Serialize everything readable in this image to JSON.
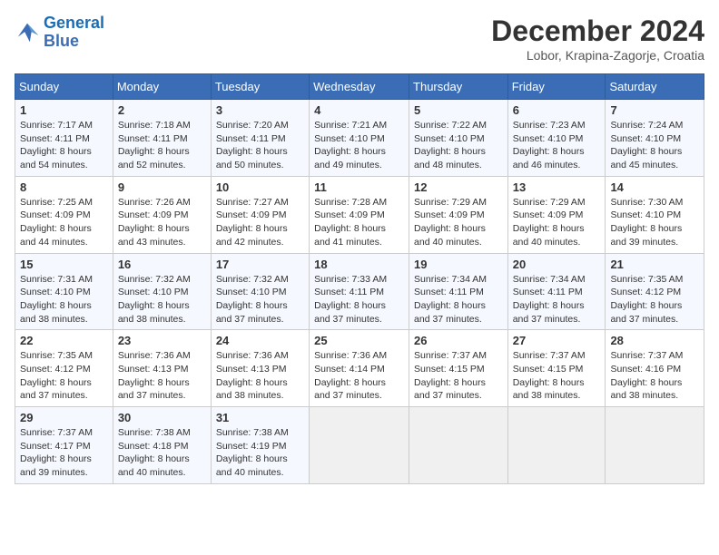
{
  "header": {
    "logo_line1": "General",
    "logo_line2": "Blue",
    "title": "December 2024",
    "location": "Lobor, Krapina-Zagorje, Croatia"
  },
  "weekdays": [
    "Sunday",
    "Monday",
    "Tuesday",
    "Wednesday",
    "Thursday",
    "Friday",
    "Saturday"
  ],
  "weeks": [
    [
      {
        "day": 1,
        "info": "Sunrise: 7:17 AM\nSunset: 4:11 PM\nDaylight: 8 hours\nand 54 minutes."
      },
      {
        "day": 2,
        "info": "Sunrise: 7:18 AM\nSunset: 4:11 PM\nDaylight: 8 hours\nand 52 minutes."
      },
      {
        "day": 3,
        "info": "Sunrise: 7:20 AM\nSunset: 4:11 PM\nDaylight: 8 hours\nand 50 minutes."
      },
      {
        "day": 4,
        "info": "Sunrise: 7:21 AM\nSunset: 4:10 PM\nDaylight: 8 hours\nand 49 minutes."
      },
      {
        "day": 5,
        "info": "Sunrise: 7:22 AM\nSunset: 4:10 PM\nDaylight: 8 hours\nand 48 minutes."
      },
      {
        "day": 6,
        "info": "Sunrise: 7:23 AM\nSunset: 4:10 PM\nDaylight: 8 hours\nand 46 minutes."
      },
      {
        "day": 7,
        "info": "Sunrise: 7:24 AM\nSunset: 4:10 PM\nDaylight: 8 hours\nand 45 minutes."
      }
    ],
    [
      {
        "day": 8,
        "info": "Sunrise: 7:25 AM\nSunset: 4:09 PM\nDaylight: 8 hours\nand 44 minutes."
      },
      {
        "day": 9,
        "info": "Sunrise: 7:26 AM\nSunset: 4:09 PM\nDaylight: 8 hours\nand 43 minutes."
      },
      {
        "day": 10,
        "info": "Sunrise: 7:27 AM\nSunset: 4:09 PM\nDaylight: 8 hours\nand 42 minutes."
      },
      {
        "day": 11,
        "info": "Sunrise: 7:28 AM\nSunset: 4:09 PM\nDaylight: 8 hours\nand 41 minutes."
      },
      {
        "day": 12,
        "info": "Sunrise: 7:29 AM\nSunset: 4:09 PM\nDaylight: 8 hours\nand 40 minutes."
      },
      {
        "day": 13,
        "info": "Sunrise: 7:29 AM\nSunset: 4:09 PM\nDaylight: 8 hours\nand 40 minutes."
      },
      {
        "day": 14,
        "info": "Sunrise: 7:30 AM\nSunset: 4:10 PM\nDaylight: 8 hours\nand 39 minutes."
      }
    ],
    [
      {
        "day": 15,
        "info": "Sunrise: 7:31 AM\nSunset: 4:10 PM\nDaylight: 8 hours\nand 38 minutes."
      },
      {
        "day": 16,
        "info": "Sunrise: 7:32 AM\nSunset: 4:10 PM\nDaylight: 8 hours\nand 38 minutes."
      },
      {
        "day": 17,
        "info": "Sunrise: 7:32 AM\nSunset: 4:10 PM\nDaylight: 8 hours\nand 37 minutes."
      },
      {
        "day": 18,
        "info": "Sunrise: 7:33 AM\nSunset: 4:11 PM\nDaylight: 8 hours\nand 37 minutes."
      },
      {
        "day": 19,
        "info": "Sunrise: 7:34 AM\nSunset: 4:11 PM\nDaylight: 8 hours\nand 37 minutes."
      },
      {
        "day": 20,
        "info": "Sunrise: 7:34 AM\nSunset: 4:11 PM\nDaylight: 8 hours\nand 37 minutes."
      },
      {
        "day": 21,
        "info": "Sunrise: 7:35 AM\nSunset: 4:12 PM\nDaylight: 8 hours\nand 37 minutes."
      }
    ],
    [
      {
        "day": 22,
        "info": "Sunrise: 7:35 AM\nSunset: 4:12 PM\nDaylight: 8 hours\nand 37 minutes."
      },
      {
        "day": 23,
        "info": "Sunrise: 7:36 AM\nSunset: 4:13 PM\nDaylight: 8 hours\nand 37 minutes."
      },
      {
        "day": 24,
        "info": "Sunrise: 7:36 AM\nSunset: 4:13 PM\nDaylight: 8 hours\nand 38 minutes."
      },
      {
        "day": 25,
        "info": "Sunrise: 7:36 AM\nSunset: 4:14 PM\nDaylight: 8 hours\nand 37 minutes."
      },
      {
        "day": 26,
        "info": "Sunrise: 7:37 AM\nSunset: 4:15 PM\nDaylight: 8 hours\nand 37 minutes."
      },
      {
        "day": 27,
        "info": "Sunrise: 7:37 AM\nSunset: 4:15 PM\nDaylight: 8 hours\nand 38 minutes."
      },
      {
        "day": 28,
        "info": "Sunrise: 7:37 AM\nSunset: 4:16 PM\nDaylight: 8 hours\nand 38 minutes."
      }
    ],
    [
      {
        "day": 29,
        "info": "Sunrise: 7:37 AM\nSunset: 4:17 PM\nDaylight: 8 hours\nand 39 minutes."
      },
      {
        "day": 30,
        "info": "Sunrise: 7:38 AM\nSunset: 4:18 PM\nDaylight: 8 hours\nand 40 minutes."
      },
      {
        "day": 31,
        "info": "Sunrise: 7:38 AM\nSunset: 4:19 PM\nDaylight: 8 hours\nand 40 minutes."
      },
      null,
      null,
      null,
      null
    ]
  ]
}
